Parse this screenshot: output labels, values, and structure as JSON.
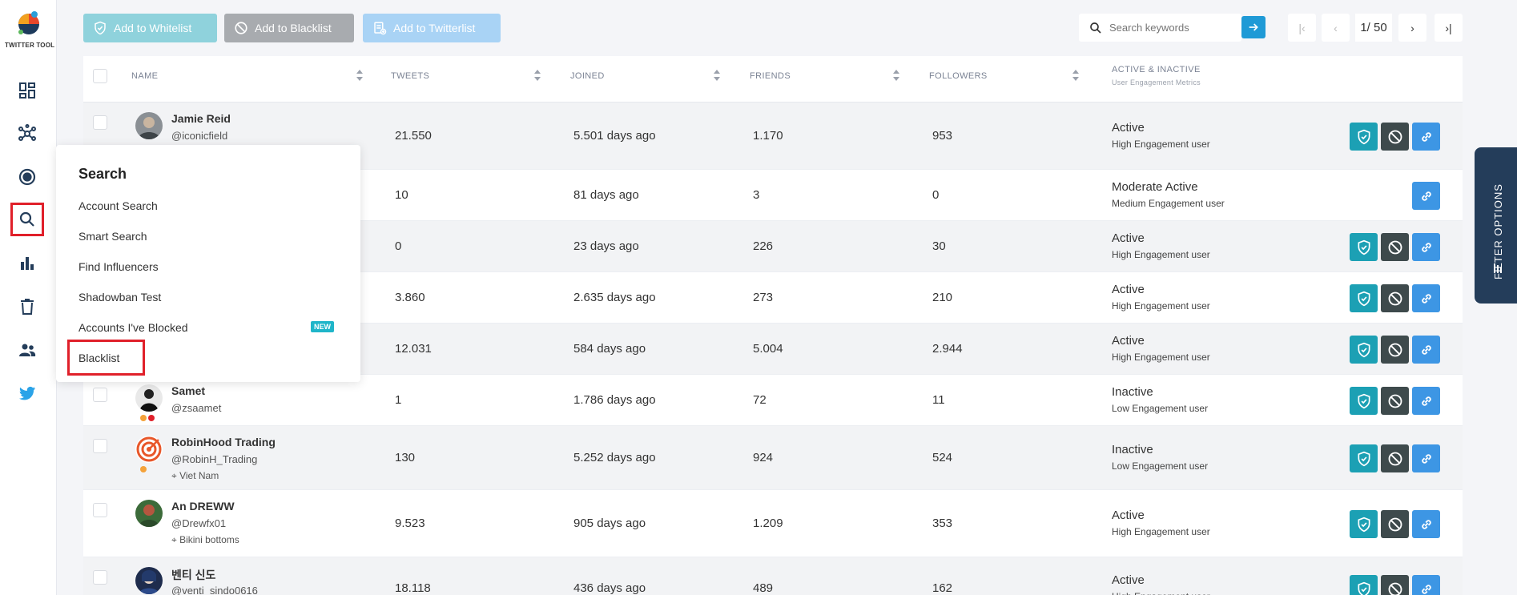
{
  "app": {
    "name": "TWITTER TOOL"
  },
  "toolbar": {
    "whitelist_label": "Add to Whitelist",
    "blacklist_label": "Add to Blacklist",
    "twitterlist_label": "Add to Twitterlist"
  },
  "search": {
    "placeholder": "Search keywords"
  },
  "pagination": {
    "label": "1/ 50"
  },
  "table": {
    "headers": {
      "name": "NAME",
      "tweets": "TWEETS",
      "joined": "JOINED",
      "friends": "FRIENDS",
      "followers": "FOLLOWERS",
      "status": "ACTIVE & INACTIVE",
      "status_sub": "User Engagement Metrics"
    },
    "rows": [
      {
        "name": "Jamie Reid",
        "handle": "@iconicfield",
        "location": "",
        "tweets": "21.550",
        "joined": "5.501 days ago",
        "friends": "1.170",
        "followers": "953",
        "status": "Active",
        "engagement": "High Engagement user"
      },
      {
        "name": "",
        "handle": "",
        "location": "",
        "tweets": "10",
        "joined": "81 days ago",
        "friends": "3",
        "followers": "0",
        "status": "Moderate Active",
        "engagement": "Medium Engagement user"
      },
      {
        "name": "",
        "handle": "",
        "location": "",
        "tweets": "0",
        "joined": "23 days ago",
        "friends": "226",
        "followers": "30",
        "status": "Active",
        "engagement": "High Engagement user"
      },
      {
        "name": "",
        "handle": "",
        "location": "",
        "tweets": "3.860",
        "joined": "2.635 days ago",
        "friends": "273",
        "followers": "210",
        "status": "Active",
        "engagement": "High Engagement user"
      },
      {
        "name": "",
        "handle": "",
        "location": "",
        "tweets": "12.031",
        "joined": "584 days ago",
        "friends": "5.004",
        "followers": "2.944",
        "status": "Active",
        "engagement": "High Engagement user"
      },
      {
        "name": "Samet",
        "handle": "@zsaamet",
        "location": "",
        "tweets": "1",
        "joined": "1.786 days ago",
        "friends": "72",
        "followers": "11",
        "status": "Inactive",
        "engagement": "Low Engagement user"
      },
      {
        "name": "RobinHood Trading",
        "handle": "@RobinH_Trading",
        "location": "Viet Nam",
        "tweets": "130",
        "joined": "5.252 days ago",
        "friends": "924",
        "followers": "524",
        "status": "Inactive",
        "engagement": "Low Engagement user"
      },
      {
        "name": "An DREWW",
        "handle": "@Drewfx01",
        "location": "Bikini bottoms",
        "tweets": "9.523",
        "joined": "905 days ago",
        "friends": "1.209",
        "followers": "353",
        "status": "Active",
        "engagement": "High Engagement user"
      },
      {
        "name": "벤티 신도",
        "handle": "@venti_sindo0616",
        "location": "",
        "tweets": "18.118",
        "joined": "436 days ago",
        "friends": "489",
        "followers": "162",
        "status": "Active",
        "engagement": "High Engagement user"
      }
    ]
  },
  "menu": {
    "title": "Search",
    "items": [
      "Account Search",
      "Smart Search",
      "Find Influencers",
      "Shadowban Test",
      "Accounts I've Blocked",
      "Blacklist"
    ],
    "badge": "NEW"
  },
  "filter": {
    "label": "FILTER OPTIONS"
  },
  "colors": {
    "whitelist": "#1ca0b4",
    "blacklist": "#3e4a4c",
    "link": "#3d96e4",
    "highlight": "#e0202a",
    "filter_tab": "#243d5a"
  }
}
